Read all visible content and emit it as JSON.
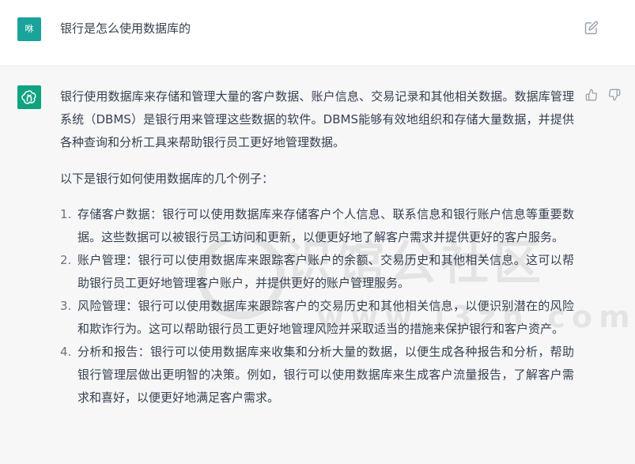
{
  "user": {
    "avatar_text": "咻",
    "message": "银行是怎么使用数据库的"
  },
  "assistant": {
    "paragraph1": "银行使用数据库来存储和管理大量的客户数据、账户信息、交易记录和其他相关数据。数据库管理系统（DBMS）是银行用来管理这些数据的软件。DBMS能够有效地组织和存储大量数据，并提供各种查询和分析工具来帮助银行员工更好地管理数据。",
    "intro": "以下是银行如何使用数据库的几个例子：",
    "items": [
      {
        "num": "1.",
        "text": "存储客户数据：银行可以使用数据库来存储客户个人信息、联系信息和银行账户信息等重要数据。这些数据可以被银行员工访问和更新，以便更好地了解客户需求并提供更好的客户服务。"
      },
      {
        "num": "2.",
        "text": "账户管理：银行可以使用数据库来跟踪客户账户的余额、交易历史和其他相关信息。这可以帮助银行员工更好地管理客户账户，并提供更好的账户管理服务。"
      },
      {
        "num": "3.",
        "text": "风险管理：银行可以使用数据库来跟踪客户的交易历史和其他相关信息，以便识别潜在的风险和欺诈行为。这可以帮助银行员工更好地管理风险并采取适当的措施来保护银行和客户资产。"
      },
      {
        "num": "4.",
        "text": "分析和报告：银行可以使用数据库来收集和分析大量的数据，以便生成各种报告和分析，帮助银行管理层做出更明智的决策。例如，银行可以使用数据库来生成客户流量报告，了解客户需求和喜好，以便更好地满足客户需求。"
      }
    ]
  },
  "watermark": {
    "text": "识馆公社区",
    "url": "www.i3zh.com"
  },
  "icons": {
    "edit": "edit-icon",
    "thumb_up": "thumbs-up-icon",
    "thumb_down": "thumbs-down-icon",
    "bot_logo": "openai-logo-icon"
  },
  "colors": {
    "user_avatar": "#1aa39a",
    "bot_avatar": "#10a37f",
    "assistant_bg": "#f7f7f8",
    "text": "#374151"
  }
}
